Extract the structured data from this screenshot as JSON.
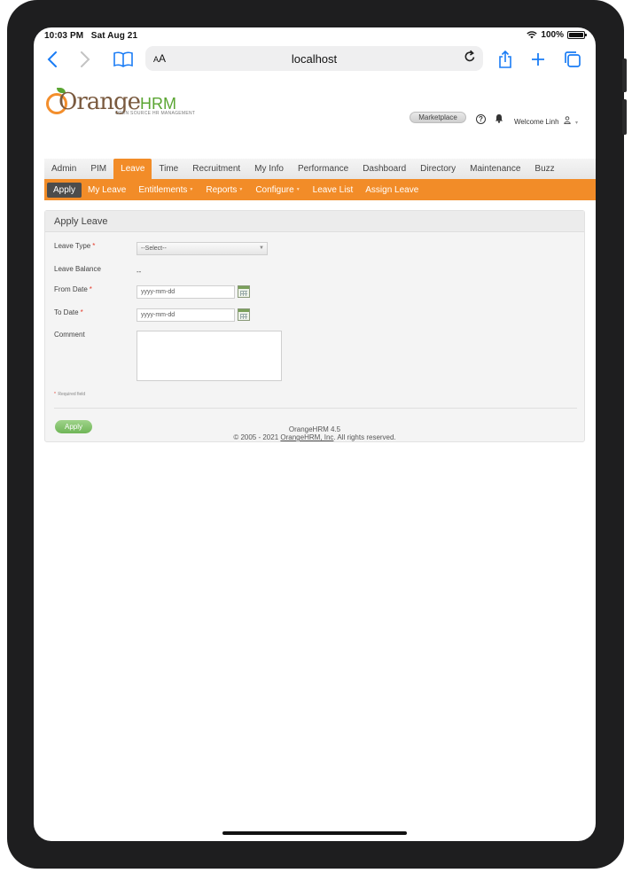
{
  "status_bar": {
    "time": "10:03 PM",
    "date": "Sat Aug 21",
    "battery": "100%",
    "battery_level": 1.0
  },
  "browser": {
    "text_size_label_large": "A",
    "text_size_label_small": "A",
    "url": "localhost"
  },
  "header": {
    "logo": {
      "brand_main": "Orange",
      "brand_accent": "HRM",
      "tagline": "OPEN SOURCE HR MANAGEMENT"
    },
    "marketplace_label": "Marketplace",
    "help_symbol": "?",
    "welcome_text": "Welcome Linh"
  },
  "main_menu": {
    "items": [
      "Admin",
      "PIM",
      "Leave",
      "Time",
      "Recruitment",
      "My Info",
      "Performance",
      "Dashboard",
      "Directory",
      "Maintenance",
      "Buzz"
    ],
    "active": "Leave"
  },
  "sub_menu": {
    "items": [
      {
        "label": "Apply",
        "dropdown": false
      },
      {
        "label": "My Leave",
        "dropdown": false
      },
      {
        "label": "Entitlements",
        "dropdown": true
      },
      {
        "label": "Reports",
        "dropdown": true
      },
      {
        "label": "Configure",
        "dropdown": true
      },
      {
        "label": "Leave List",
        "dropdown": false
      },
      {
        "label": "Assign Leave",
        "dropdown": false
      }
    ],
    "active": "Apply"
  },
  "form": {
    "title": "Apply Leave",
    "leave_type_label": "Leave Type",
    "leave_type_value": "--Select--",
    "leave_balance_label": "Leave Balance",
    "leave_balance_value": "--",
    "from_date_label": "From Date",
    "from_date_value": "yyyy-mm-dd",
    "to_date_label": "To Date",
    "to_date_value": "yyyy-mm-dd",
    "comment_label": "Comment",
    "comment_value": "",
    "required_marker": "*",
    "required_note": "Required field",
    "apply_label": "Apply"
  },
  "footer": {
    "version": "OrangeHRM 4.5",
    "copyright_prefix": "© 2005 - 2021",
    "company_link": "OrangeHRM, Inc",
    "copyright_suffix": ". All rights reserved."
  },
  "colors": {
    "accent": "#f28c28",
    "submenu_active": "#4c4c4c",
    "apply_button": "#7dbf63",
    "brand_green": "#5aa532",
    "safari_blue": "#1a7cf5"
  }
}
